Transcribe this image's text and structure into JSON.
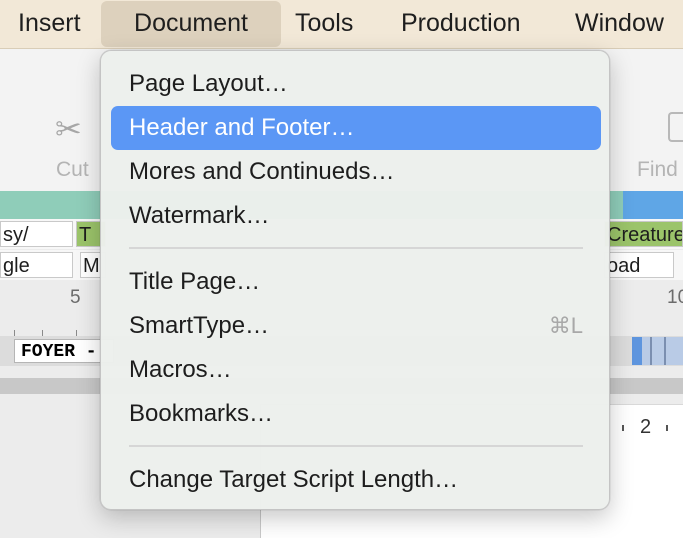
{
  "menubar": {
    "items": [
      "Insert",
      "Document",
      "Tools",
      "Production",
      "Window"
    ]
  },
  "toolbar": {
    "cut_label": "Cut",
    "find_label": "Find"
  },
  "background": {
    "row1": [
      "sy/",
      "T",
      "Creature"
    ],
    "row2": [
      "gle",
      "M",
      "oad"
    ],
    "ruler": [
      "5",
      "10"
    ],
    "scene": "FOYER -",
    "page_number": "2"
  },
  "menu": {
    "items": [
      {
        "label": "Page Layout…",
        "shortcut": ""
      },
      {
        "label": "Header and Footer…",
        "shortcut": ""
      },
      {
        "label": "Mores and Continueds…",
        "shortcut": ""
      },
      {
        "label": "Watermark…",
        "shortcut": ""
      },
      {
        "label": "Title Page…",
        "shortcut": ""
      },
      {
        "label": "SmartType…",
        "shortcut": "⌘L"
      },
      {
        "label": "Macros…",
        "shortcut": ""
      },
      {
        "label": "Bookmarks…",
        "shortcut": ""
      },
      {
        "label": "Change Target Script Length…",
        "shortcut": ""
      }
    ]
  },
  "colors": {
    "menubar_bg": "#f2e8d7",
    "highlight": "#5b97f5",
    "teal_strip": "#8fcdb9",
    "green_cell": "#9bc46a"
  }
}
